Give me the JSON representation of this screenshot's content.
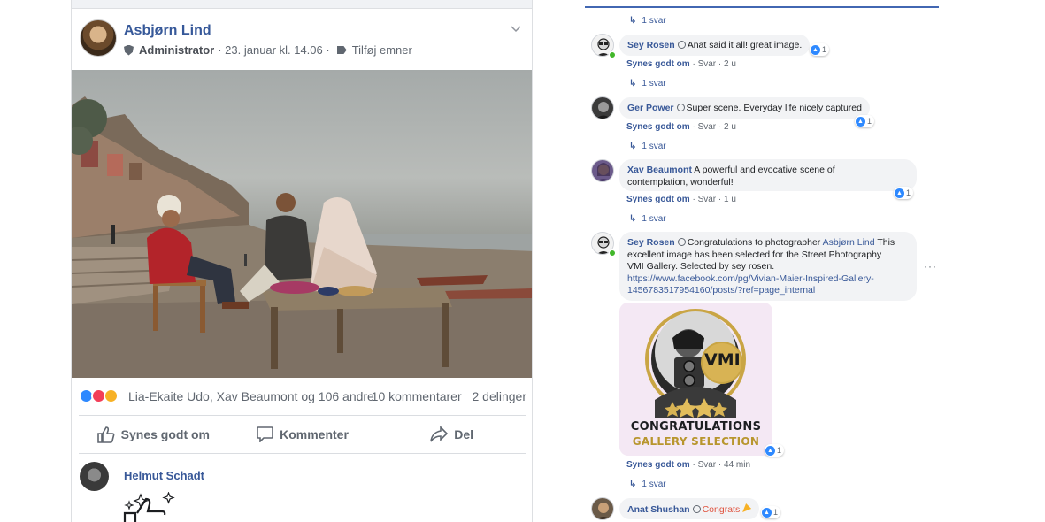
{
  "post": {
    "author": "Asbjørn Lind",
    "role": "Administrator",
    "date": "· 23. januar kl. 14.06 ·",
    "add_topics": "Tilføj emner",
    "reactions_text": "Lia-Ekaite Udo, Xav Beaumont og 106 andre",
    "comments_count": "10 kommentarer",
    "shares_count": "2 delinger",
    "actions": {
      "like": "Synes godt om",
      "comment": "Kommenter",
      "share": "Del"
    },
    "first_commenter": "Helmut Schadt"
  },
  "comments_panel": {
    "reply_links": [
      "1 svar",
      "1 svar",
      "1 svar",
      "1 svar",
      "1 svar"
    ],
    "comments": [
      {
        "author": "Sey Rosen",
        "text": "Anat said it all! great image.",
        "like_label": "Synes godt om",
        "reply_label": "Svar",
        "time": "2 u",
        "likes": "1"
      },
      {
        "author": "Ger Power",
        "text": "Super scene. Everyday life nicely captured",
        "like_label": "Synes godt om",
        "reply_label": "Svar",
        "time": "2 u",
        "likes": "1"
      },
      {
        "author": "Xav Beaumont",
        "text_line1": "A powerful and evocative scene of",
        "text_line2": "contemplation, wonderful!",
        "like_label": "Synes godt om",
        "reply_label": "Svar",
        "time": "1 u",
        "likes": "1"
      },
      {
        "author": "Sey Rosen",
        "text_pre": "Congratulations to photographer",
        "mention": "Asbjørn Lind",
        "text_line1_end": "This",
        "text_line2": "excellent image has been selected for the Street Photography",
        "text_line3": "VMI Gallery. Selected by sey rosen.",
        "link_line1": "https://www.facebook.com/pg/Vivian-Maier-Inspired-Gallery-",
        "link_line2": "1456783517954160/posts/?ref=page_internal",
        "like_label": "Synes godt om",
        "reply_label": "Svar",
        "time": "44 min",
        "likes": "1",
        "image": {
          "logo_text": "VMI",
          "line1": "CONGRATULATIONS",
          "line2": "GALLERY SELECTION"
        }
      },
      {
        "author": "Anat Shushan",
        "text": "Congrats",
        "likes": "1"
      }
    ],
    "more_options": "···"
  },
  "colors": {
    "link_blue": "#385898",
    "like_blue": "#2e89ff",
    "accent_line": "#4267b2",
    "congrats_red": "#e0533f",
    "gold": "#b8962e"
  }
}
